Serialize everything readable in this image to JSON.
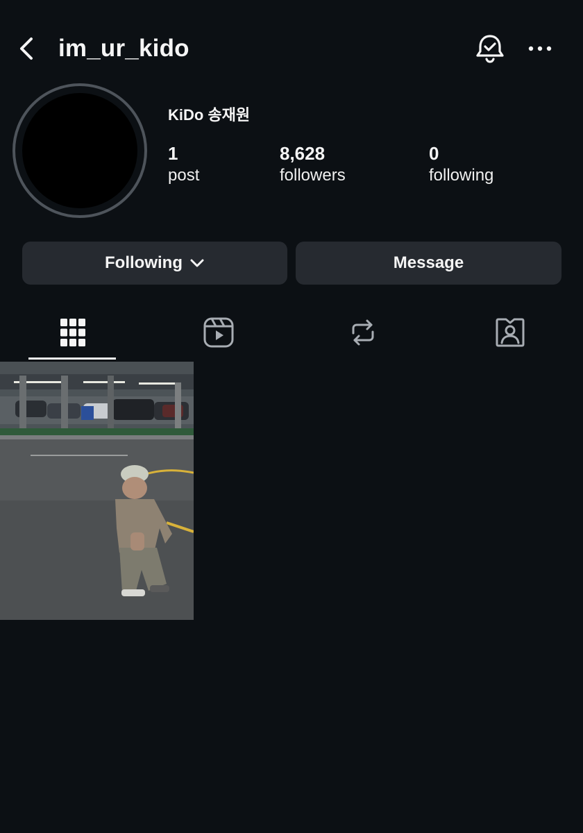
{
  "header": {
    "username": "im_ur_kido",
    "back_icon": "chevron-left-icon",
    "notification_icon": "bell-check-icon",
    "more_icon": "more-horizontal-icon"
  },
  "profile": {
    "display_name": "KiDo 송재원",
    "stats": {
      "posts_count": "1",
      "posts_label": "post",
      "followers_count": "8,628",
      "followers_label": "followers",
      "following_count": "0",
      "following_label": "following"
    }
  },
  "actions": {
    "following_label": "Following",
    "message_label": "Message"
  },
  "tabs": [
    {
      "name": "posts-grid",
      "icon": "grid-icon",
      "active": true
    },
    {
      "name": "reels",
      "icon": "reels-icon",
      "active": false
    },
    {
      "name": "reposts",
      "icon": "repost-icon",
      "active": false
    },
    {
      "name": "tagged",
      "icon": "tagged-person-icon",
      "active": false
    }
  ],
  "colors": {
    "background": "#0c1014",
    "button_bg": "#262a30",
    "text": "#f5f5f5",
    "avatar_ring": "#4e545b"
  },
  "posts": [
    {
      "description_icon": "photo-thumbnail"
    }
  ]
}
